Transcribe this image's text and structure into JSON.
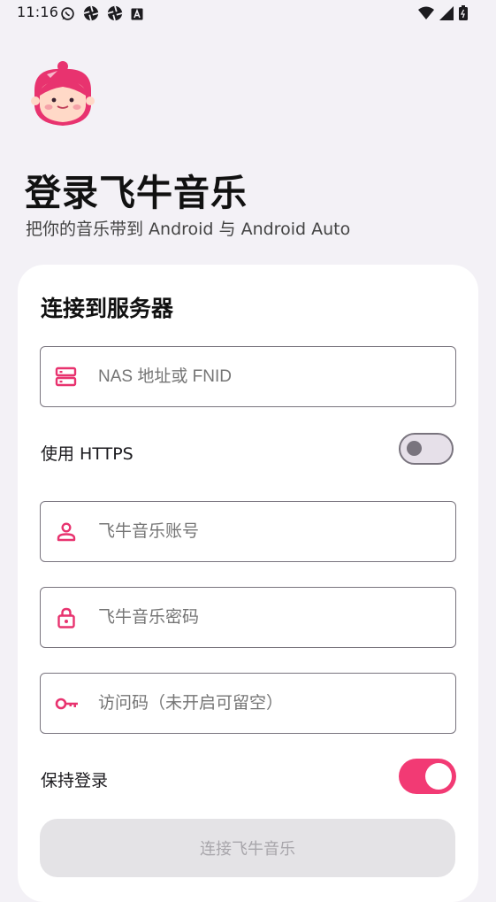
{
  "status_bar": {
    "time": "11:16"
  },
  "header": {
    "title": "登录飞牛音乐",
    "subtitle": "把你的音乐带到 Android 与 Android Auto"
  },
  "form": {
    "title": "连接到服务器",
    "server_placeholder": "NAS 地址或 FNID",
    "https_label": "使用 HTTPS",
    "https_enabled": false,
    "username_placeholder": "飞牛音乐账号",
    "password_placeholder": "飞牛音乐密码",
    "access_code_placeholder": "访问码（未开启可留空）",
    "keep_login_label": "保持登录",
    "keep_login_enabled": true,
    "connect_button": "连接飞牛音乐"
  },
  "colors": {
    "accent": "#f23a74",
    "background": "#f3f1f6",
    "card": "#ffffff"
  }
}
